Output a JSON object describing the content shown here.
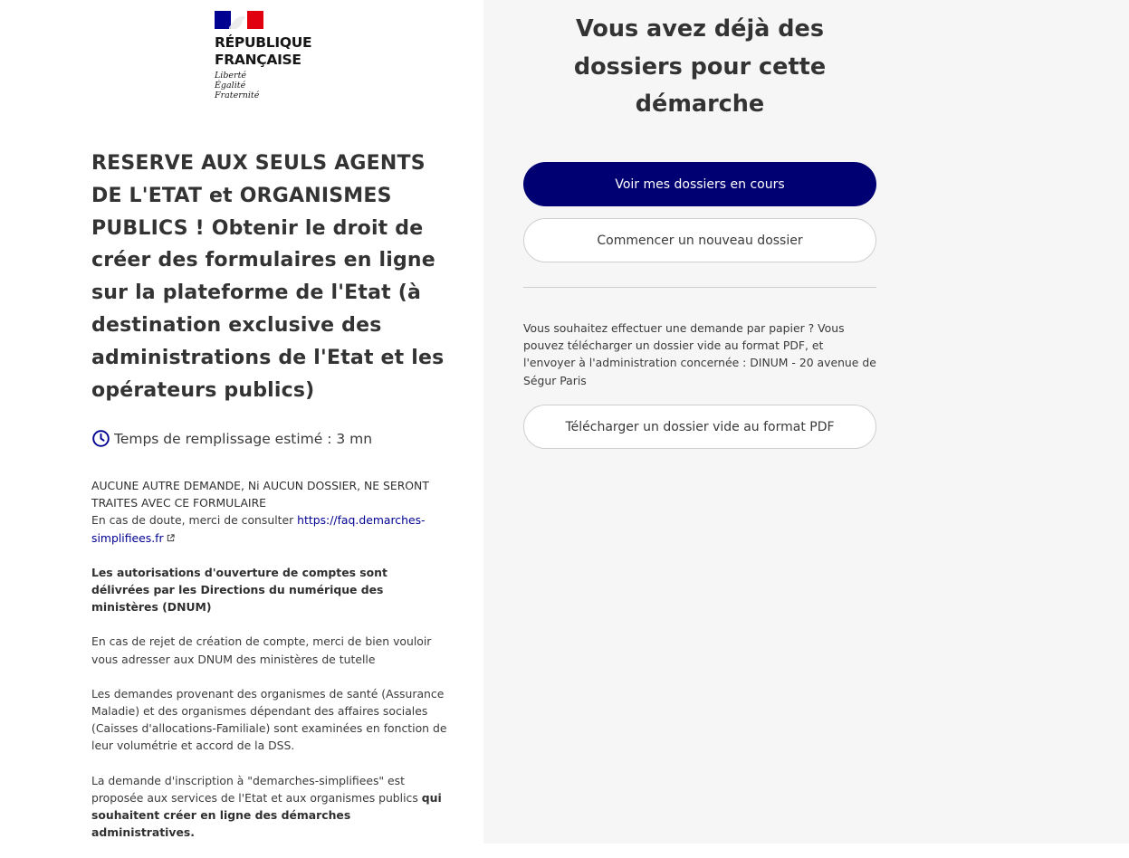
{
  "header": {
    "logo_name_line1": "RÉPUBLIQUE",
    "logo_name_line2": "FRANÇAISE",
    "motto_1": "Liberté",
    "motto_2": "Égalité",
    "motto_3": "Fraternité",
    "flag_colors": {
      "blue": "#000091",
      "white": "#ffffff",
      "red": "#e1000f"
    }
  },
  "procedure": {
    "title": "RESERVE AUX SEULS AGENTS DE L'ETAT et ORGANISMES PUBLICS ! Obtenir le droit de créer des formulaires en ligne sur la plateforme de l'Etat (à destination exclusive des administrations de l'Etat et les opérateurs publics)",
    "duration_icon": "clock-icon",
    "duration": "Temps de remplissage estimé : 3 mn",
    "description": {
      "p1_caps": "AUCUNE AUTRE DEMANDE, Ni AUCUN DOSSIER, NE SERONT TRAITES AVEC CE FORMULAIRE",
      "p1_text": "En cas de doute, merci de consulter ",
      "p1_link": "https://faq.demarches-simplifiees.fr",
      "p2": "Les autorisations d'ouverture de comptes sont délivrées par les Directions du numérique des ministères (DNUM)",
      "p3": "En cas de rejet de création de compte, merci de bien vouloir vous adresser aux DNUM des ministères de tutelle",
      "p4": "Les demandes provenant des organismes de santé (Assurance Maladie) et des organismes dépendant des affaires sociales (Caisses d'allocations-Familiale) sont examinées en fonction de leur volumétrie et accord de la DSS.",
      "p5_text": "La demande d'inscription à \"demarches-simplifiees\" est proposée aux services de l'Etat et aux organismes publics ",
      "p5_strong": "qui souhaitent créer en ligne des démarches administratives."
    }
  },
  "dossiers": {
    "title": "Vous avez déjà des dossiers pour cette démarche",
    "view_button": "Voir mes dossiers en cours",
    "new_button": "Commencer un nouveau dossier",
    "paper_text": "Vous souhaitez effectuer une demande par papier ? Vous pouvez télécharger un dossier vide au format PDF, et l'envoyer à l'administration concernée : DINUM - 20 avenue de Ségur Paris",
    "pdf_button": "Télécharger un dossier vide au format PDF",
    "accent_color": "#000073"
  }
}
